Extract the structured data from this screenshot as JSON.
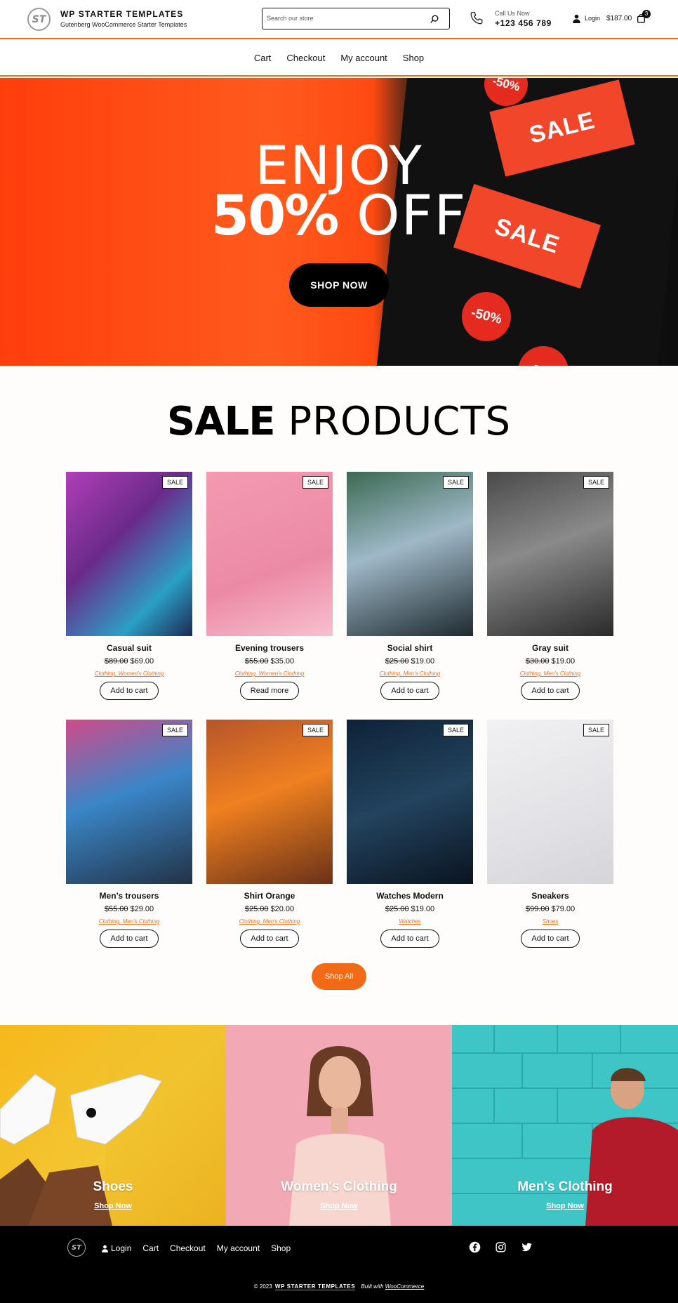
{
  "header": {
    "logo_mark": "ST",
    "title": "WP STARTER TEMPLATES",
    "subtitle": "Gutenberg WooCommerce Starter Templates",
    "search_placeholder": "Search our store",
    "call_label": "Call Us Now",
    "phone": "+123 456 789",
    "login": "Login",
    "cart_total": "$187.00",
    "cart_count": "3"
  },
  "nav": [
    "Cart",
    "Checkout",
    "My account",
    "Shop"
  ],
  "hero": {
    "line1": "ENJOY",
    "line2_bold": "50%",
    "line2_light": " OFF",
    "button": "SHOP NOW",
    "tag_text": "SALE",
    "dot_text": "-50%",
    "colors": {
      "orange": "#ff4a12",
      "dark": "#111111",
      "tag": "#f2462a"
    }
  },
  "section": {
    "title_bold": "SALE",
    "title_light": " PRODUCTS"
  },
  "products": [
    {
      "name": "Casual suit",
      "old_price": "$89.00",
      "price": "$69.00",
      "cats": [
        "Clothing",
        "Women's Clothing"
      ],
      "button": "Add to cart",
      "badge": "SALE"
    },
    {
      "name": "Evening trousers",
      "old_price": "$55.00",
      "price": "$35.00",
      "cats": [
        "Clothing",
        "Women's Clothing"
      ],
      "button": "Read more",
      "badge": "SALE"
    },
    {
      "name": "Social shirt",
      "old_price": "$25.00",
      "price": "$19.00",
      "cats": [
        "Clothing",
        "Men's Clothing"
      ],
      "button": "Add to cart",
      "badge": "SALE"
    },
    {
      "name": "Gray suit",
      "old_price": "$30.00",
      "price": "$19.00",
      "cats": [
        "Clothing",
        "Men's Clothing"
      ],
      "button": "Add to cart",
      "badge": "SALE"
    },
    {
      "name": "Men’s trousers",
      "old_price": "$55.00",
      "price": "$29.00",
      "cats": [
        "Clothing",
        "Men's Clothing"
      ],
      "button": "Add to cart",
      "badge": "SALE"
    },
    {
      "name": "Shirt Orange",
      "old_price": "$25.00",
      "price": "$20.00",
      "cats": [
        "Clothing",
        "Men's Clothing"
      ],
      "button": "Add to cart",
      "badge": "SALE"
    },
    {
      "name": "Watches Modern",
      "old_price": "$25.00",
      "price": "$19.00",
      "cats": [
        "Watches"
      ],
      "button": "Add to cart",
      "badge": "SALE"
    },
    {
      "name": "Sneakers",
      "old_price": "$99.00",
      "price": "$79.00",
      "cats": [
        "Shoes"
      ],
      "button": "Add to cart",
      "badge": "SALE"
    }
  ],
  "shop_all": "Shop All",
  "categories": [
    {
      "title": "Shoes",
      "link": "Shop Now"
    },
    {
      "title": "Women's Clothing",
      "link": "Shop Now"
    },
    {
      "title": "Men's Clothing",
      "link": "Shop Now"
    }
  ],
  "footer": {
    "logo_mark": "ST",
    "login": "Login",
    "nav": [
      "Cart",
      "Checkout",
      "My account",
      "Shop"
    ],
    "copyright": "© 2023",
    "brand": "WP STARTER TEMPLATES",
    "built": "Built with",
    "built_link": "WooCommerce",
    "social": [
      "facebook-icon",
      "instagram-icon",
      "twitter-icon"
    ]
  }
}
